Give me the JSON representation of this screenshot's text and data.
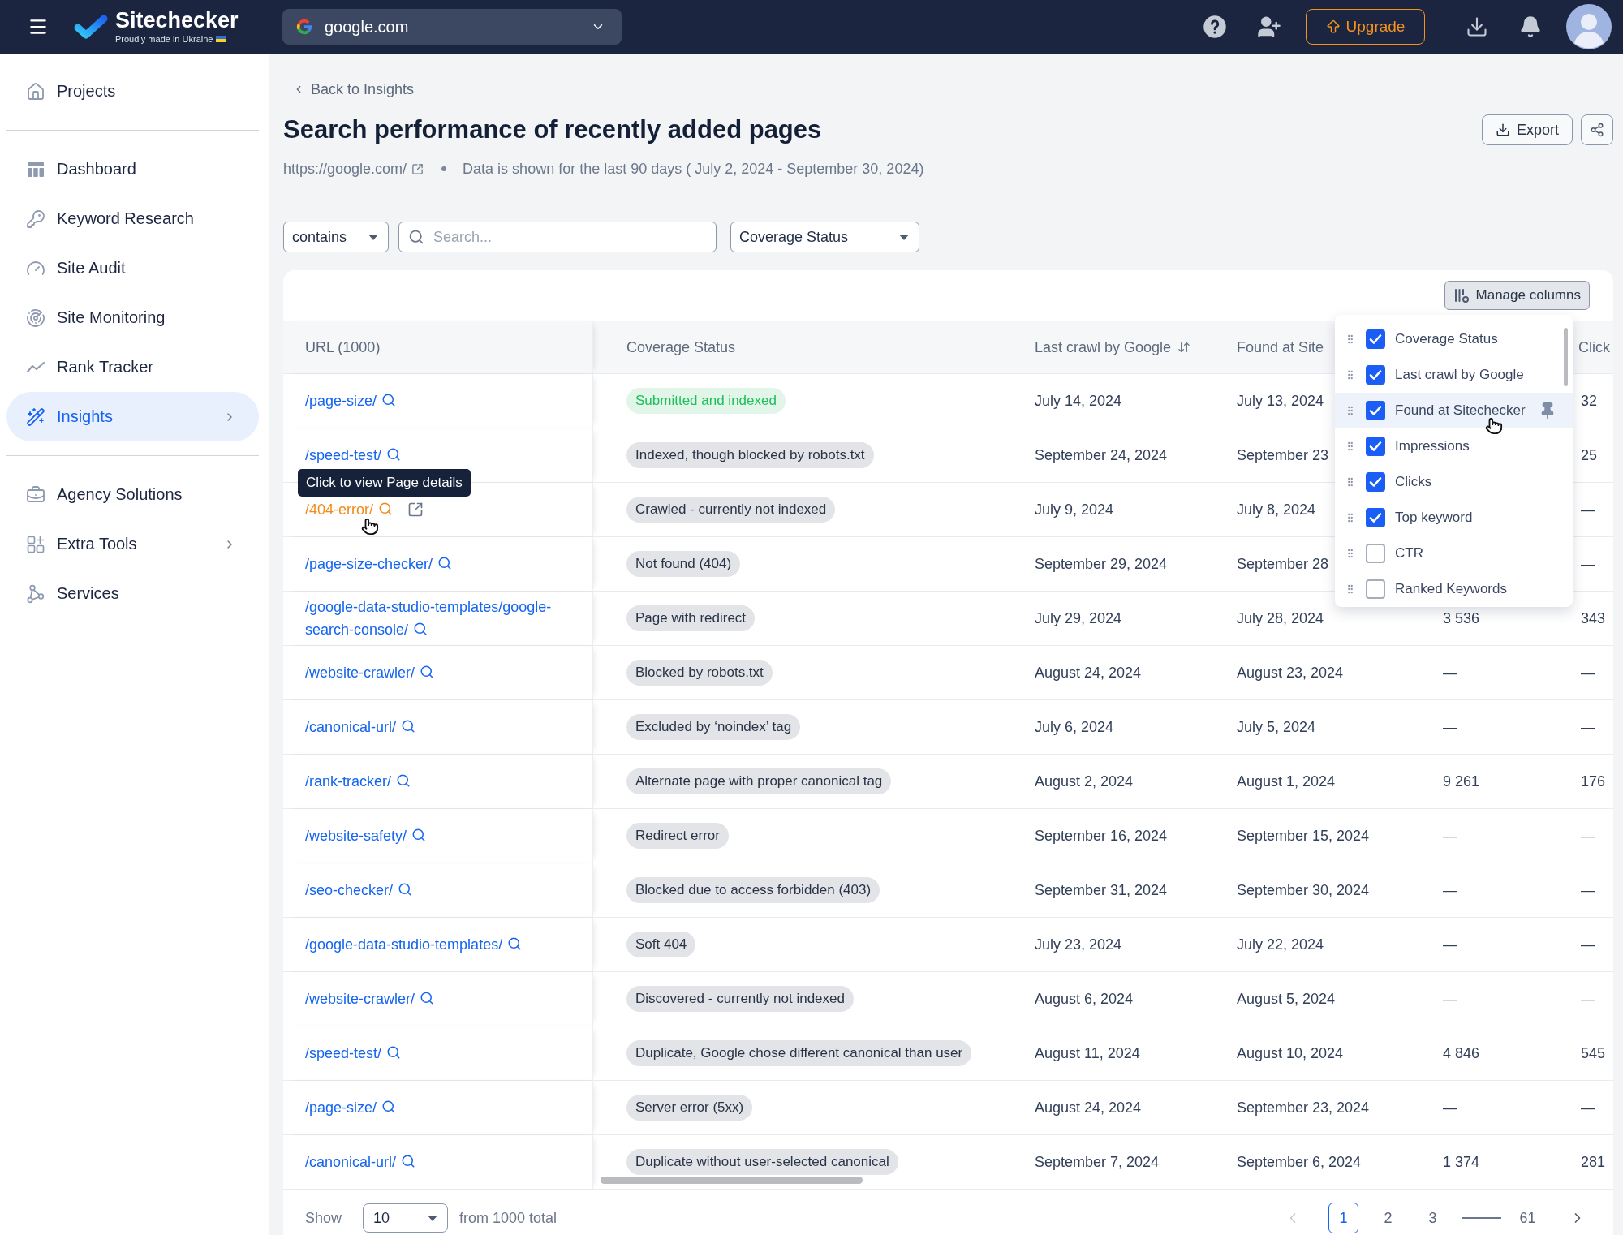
{
  "header": {
    "logo": "Sitechecker",
    "tagline": "Proudly made in Ukraine",
    "domain": "google.com",
    "upgrade": "Upgrade"
  },
  "sidebar": {
    "groups": [
      [
        {
          "label": "Projects",
          "selected": false,
          "has_submenu": false
        }
      ],
      [
        {
          "label": "Dashboard",
          "selected": false,
          "has_submenu": false
        },
        {
          "label": "Keyword Research",
          "selected": false,
          "has_submenu": false
        },
        {
          "label": "Site Audit",
          "selected": false,
          "has_submenu": false
        },
        {
          "label": "Site Monitoring",
          "selected": false,
          "has_submenu": false
        },
        {
          "label": "Rank Tracker",
          "selected": false,
          "has_submenu": false
        },
        {
          "label": "Insights",
          "selected": true,
          "has_submenu": true
        }
      ],
      [
        {
          "label": "Agency Solutions",
          "selected": false,
          "has_submenu": false
        },
        {
          "label": "Extra Tools",
          "selected": false,
          "has_submenu": true
        },
        {
          "label": "Services",
          "selected": false,
          "has_submenu": false
        }
      ]
    ]
  },
  "page": {
    "back_link": "Back to Insights",
    "title": "Search performance of recently added pages",
    "site_url": "https://google.com/",
    "date_note": "Data is shown for the last 90 days ( July 2, 2024 - September 30, 2024)",
    "export": "Export"
  },
  "filters": {
    "match_mode": "contains",
    "search": {
      "placeholder": "Search..."
    },
    "status_filter": "Coverage Status"
  },
  "table": {
    "manage_columns": "Manage columns",
    "columns": [
      {
        "label": "URL (1000)",
        "sortable": false
      },
      {
        "label": "Coverage Status",
        "sortable": false
      },
      {
        "label": "Last crawl by Google",
        "sortable": true
      },
      {
        "label": "Found at Site",
        "sortable": false
      },
      {
        "label": "Click",
        "sortable": false
      }
    ],
    "rows": [
      {
        "url": "/page-size/",
        "hovered": false,
        "coverage_status": {
          "text": "Submitted and indexed",
          "color": "#1fbf5a"
        },
        "last_crawl_by_google": "July 14, 2024",
        "column_4": "July 13, 2024",
        "column_6": "32"
      },
      {
        "url": "/speed-test/",
        "hovered": false,
        "coverage_status": {
          "text": "Indexed, though blocked by robots.txt",
          "color": "#2a3449"
        },
        "last_crawl_by_google": "September 24, 2024",
        "column_4": "September 23",
        "column_6": "25"
      },
      {
        "url": "/404-error/",
        "hovered": true,
        "tooltip": "Click to view Page details",
        "coverage_status": {
          "text": "Crawled - currently not indexed",
          "color": "#2a3449"
        },
        "last_crawl_by_google": "July 9, 2024",
        "column_4": "July 8, 2024",
        "column_6": "—"
      },
      {
        "url": "/page-size-checker/",
        "hovered": false,
        "coverage_status": {
          "text": "Not found (404)",
          "color": "#2a3449"
        },
        "last_crawl_by_google": "September 29, 2024",
        "column_4": "September 28",
        "column_6": "—"
      },
      {
        "url": "/google-data-studio-templates/google-search-console/",
        "hovered": false,
        "coverage_status": {
          "text": "Page with redirect",
          "color": "#2a3449"
        },
        "last_crawl_by_google": "July 29, 2024",
        "column_4": "July 28, 2024",
        "column_5": "3 536",
        "column_6": "343"
      },
      {
        "url": "/website-crawler/",
        "hovered": false,
        "coverage_status": {
          "text": "Blocked by robots.txt",
          "color": "#2a3449"
        },
        "last_crawl_by_google": "August 24, 2024",
        "column_4": "August 23, 2024",
        "column_5": "—",
        "column_6": "—"
      },
      {
        "url": "/canonical-url/",
        "hovered": false,
        "coverage_status": {
          "text": "Excluded by ‘noindex’ tag",
          "color": "#2a3449"
        },
        "last_crawl_by_google": "July 6, 2024",
        "column_4": "July 5, 2024",
        "column_5": "—",
        "column_6": "—"
      },
      {
        "url": "/rank-tracker/",
        "hovered": false,
        "coverage_status": {
          "text": "Alternate page with proper canonical tag",
          "color": "#2a3449"
        },
        "last_crawl_by_google": "August 2, 2024",
        "column_4": "August 1, 2024",
        "column_5": "9 261",
        "column_6": "176"
      },
      {
        "url": "/website-safety/",
        "hovered": false,
        "coverage_status": {
          "text": "Redirect error",
          "color": "#2a3449"
        },
        "last_crawl_by_google": "September 16, 2024",
        "column_4": "September 15, 2024",
        "column_5": "—",
        "column_6": "—"
      },
      {
        "url": "/seo-checker/",
        "hovered": false,
        "coverage_status": {
          "text": "Blocked due to access forbidden (403)",
          "color": "#2a3449"
        },
        "last_crawl_by_google": "September 31, 2024",
        "column_4": "September 30, 2024",
        "column_5": "—",
        "column_6": "—"
      },
      {
        "url": "/google-data-studio-templates/",
        "hovered": false,
        "coverage_status": {
          "text": "Soft 404",
          "color": "#2a3449"
        },
        "last_crawl_by_google": "July 23, 2024",
        "column_4": "July 22, 2024",
        "column_5": "—",
        "column_6": "—"
      },
      {
        "url": "/website-crawler/",
        "hovered": false,
        "coverage_status": {
          "text": "Discovered - currently not indexed",
          "color": "#2a3449"
        },
        "last_crawl_by_google": "August 6, 2024",
        "column_4": "August 5, 2024",
        "column_5": "—",
        "column_6": "—"
      },
      {
        "url": "/speed-test/",
        "hovered": false,
        "coverage_status": {
          "text": "Duplicate, Google chose different canonical than user",
          "color": "#2a3449"
        },
        "last_crawl_by_google": "August 11, 2024",
        "column_4": "August 10, 2024",
        "column_5": "4 846",
        "column_6": "545"
      },
      {
        "url": "/page-size/",
        "hovered": false,
        "coverage_status": {
          "text": "Server error (5xx)",
          "color": "#2a3449"
        },
        "last_crawl_by_google": "August 24, 2024",
        "column_4": "September 23, 2024",
        "column_5": "—",
        "column_6": "—"
      },
      {
        "url": "/canonical-url/",
        "hovered": false,
        "coverage_status": {
          "text": "Duplicate without user-selected canonical",
          "color": "#2a3449"
        },
        "last_crawl_by_google": "September 7, 2024",
        "column_4": "September 6, 2024",
        "column_5": "1 374",
        "column_6": "281"
      }
    ]
  },
  "column_menu": {
    "items": [
      {
        "label": "Coverage Status",
        "checked": true,
        "highlighted": false
      },
      {
        "label": "Last crawl by Google",
        "checked": true,
        "highlighted": false
      },
      {
        "label": "Found at Sitechecker",
        "checked": true,
        "highlighted": true
      },
      {
        "label": "Impressions",
        "checked": true,
        "highlighted": false
      },
      {
        "label": "Clicks",
        "checked": true,
        "highlighted": false
      },
      {
        "label": "Top keyword",
        "checked": true,
        "highlighted": false
      },
      {
        "label": "CTR",
        "checked": false,
        "highlighted": false
      },
      {
        "label": "Ranked Keywords",
        "checked": false,
        "highlighted": false
      }
    ]
  },
  "pagination": {
    "show_label": "Show",
    "page_size": "10",
    "total": "from 1000 total",
    "previous_disabled": true,
    "next_disabled": false,
    "pages": [
      {
        "kind": "page",
        "label": "1",
        "selected": true
      },
      {
        "kind": "page",
        "label": "2",
        "selected": false
      },
      {
        "kind": "page",
        "label": "3",
        "selected": false
      },
      {
        "kind": "gap"
      },
      {
        "kind": "page",
        "label": "61",
        "selected": false
      }
    ]
  }
}
